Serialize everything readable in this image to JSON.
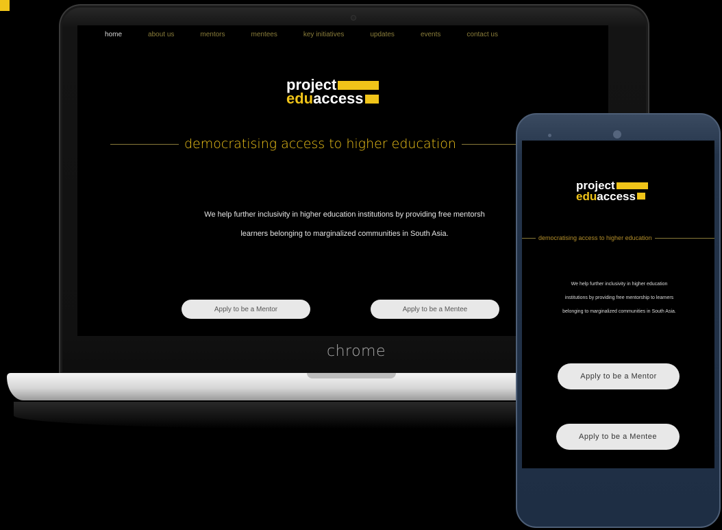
{
  "site": {
    "nav": [
      "home",
      "about us",
      "mentors",
      "mentees",
      "key initiatives",
      "updates",
      "events",
      "contact us"
    ],
    "logo": {
      "line1": "project",
      "line2_highlight": "edu",
      "line2_rest": "access"
    },
    "tagline": "democratising access to higher education",
    "description": "We help further inclusivity in higher education institutions by providing free mentorship to learners belonging to marginalized communities in South Asia.",
    "laptop_description_visible": [
      "We help further inclusivity in higher education institutions by providing free mentorsh",
      "learners belonging to marginalized communities in South Asia."
    ],
    "buttons": {
      "mentor": "Apply to be a Mentor",
      "mentee": "Apply to be a Mentee"
    }
  },
  "laptop": {
    "brand": "chrome"
  },
  "phone": {
    "description_lines": [
      "We help further inclusivity in higher education",
      "institutions by providing free mentorship to learners",
      "belonging to marginalized communities in South Asia."
    ]
  },
  "colors": {
    "accent": "#f0c419",
    "background": "#000000",
    "button": "#e8e8e8"
  }
}
